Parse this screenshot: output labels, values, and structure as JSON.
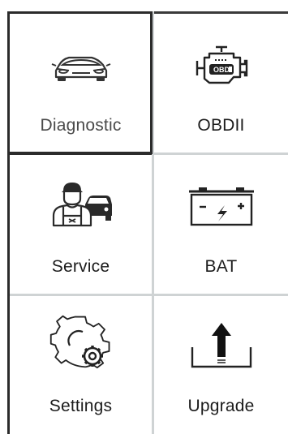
{
  "tiles": [
    {
      "label": "Diagnostic",
      "icon": "car-icon",
      "selected": true
    },
    {
      "label": "OBDII",
      "icon": "engine-obd-icon",
      "selected": false
    },
    {
      "label": "Service",
      "icon": "mechanic-car-icon",
      "selected": false
    },
    {
      "label": "BAT",
      "icon": "battery-icon",
      "selected": false
    },
    {
      "label": "Settings",
      "icon": "gear-icon",
      "selected": false
    },
    {
      "label": "Upgrade",
      "icon": "upload-icon",
      "selected": false
    }
  ],
  "colors": {
    "selected_border": "#2b2b2b",
    "divider": "#cfd3d4",
    "text": "#1c1c1c"
  }
}
